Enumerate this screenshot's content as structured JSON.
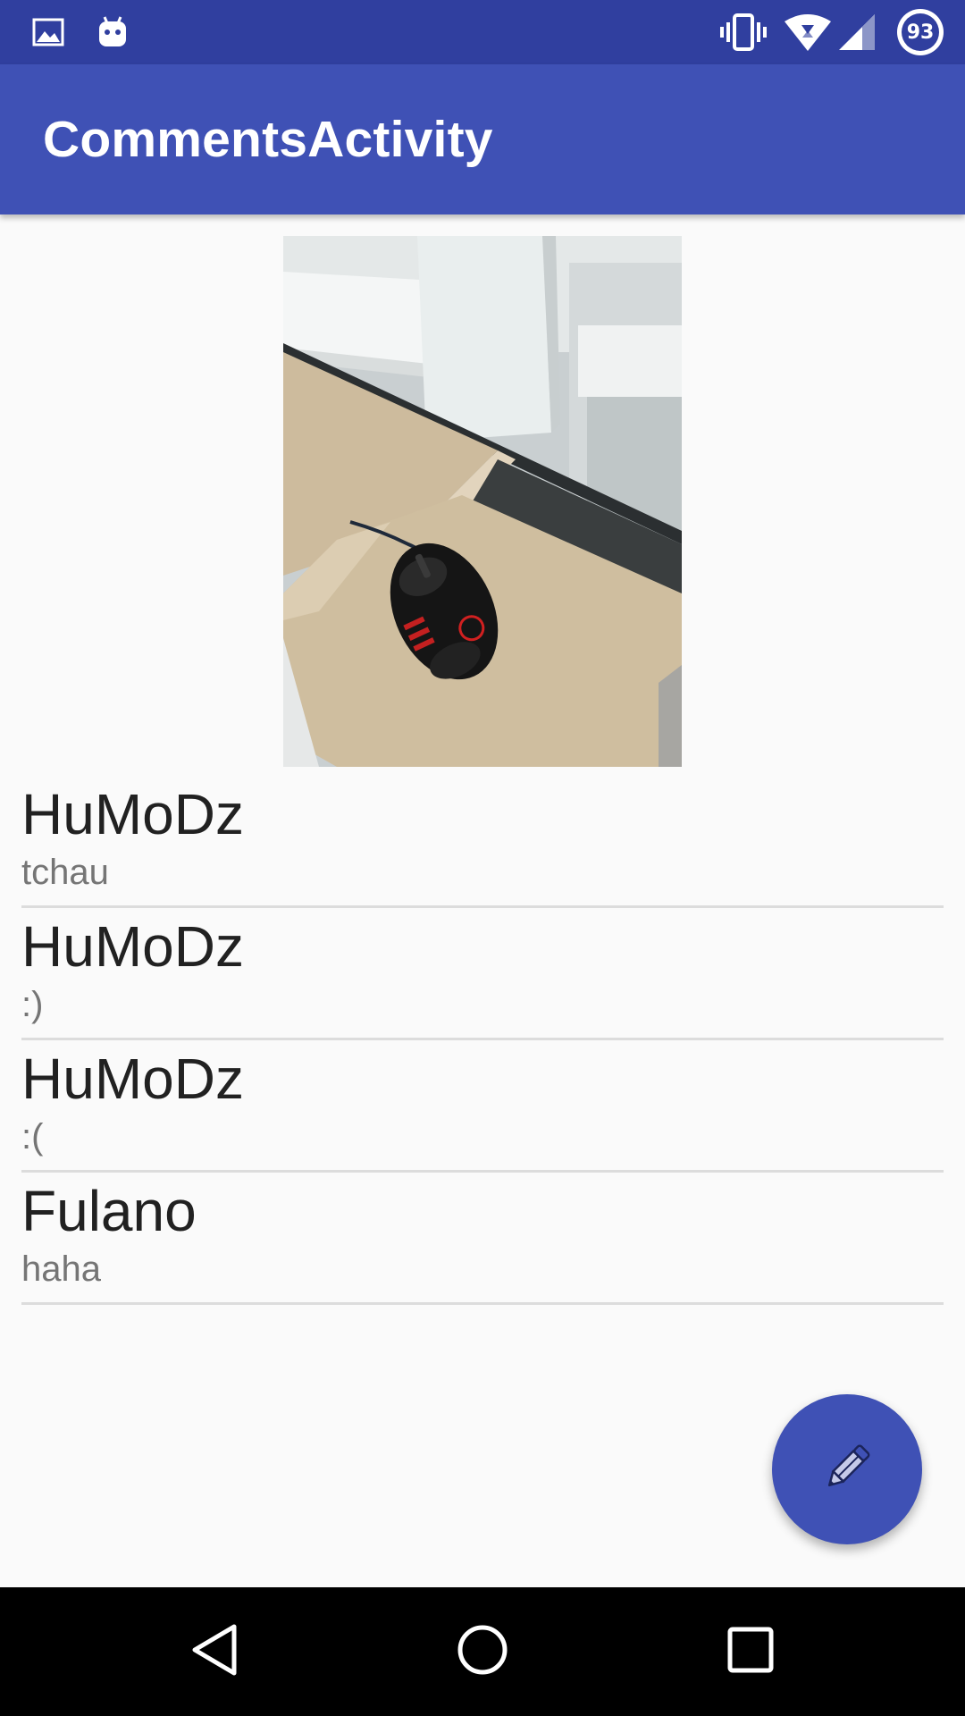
{
  "status_bar": {
    "icons": [
      "image-icon",
      "android-icon",
      "vibrate-icon",
      "wifi-icon",
      "signal-icon"
    ],
    "battery_level": "93"
  },
  "app_bar": {
    "title": "CommentsActivity"
  },
  "post": {
    "image_icon": "computer-mouse-photo"
  },
  "comments": [
    {
      "author": "HuMoDz",
      "text": "tchau"
    },
    {
      "author": "HuMoDz",
      "text": ":)"
    },
    {
      "author": "HuMoDz",
      "text": ":("
    },
    {
      "author": "Fulano",
      "text": "haha"
    }
  ],
  "fab": {
    "icon": "pencil-icon"
  },
  "nav_bar": {
    "icons": [
      "back-icon",
      "home-icon",
      "recents-icon"
    ]
  },
  "colors": {
    "status_bar": "#303f9f",
    "primary": "#3f51b5",
    "background": "#fafafa"
  }
}
